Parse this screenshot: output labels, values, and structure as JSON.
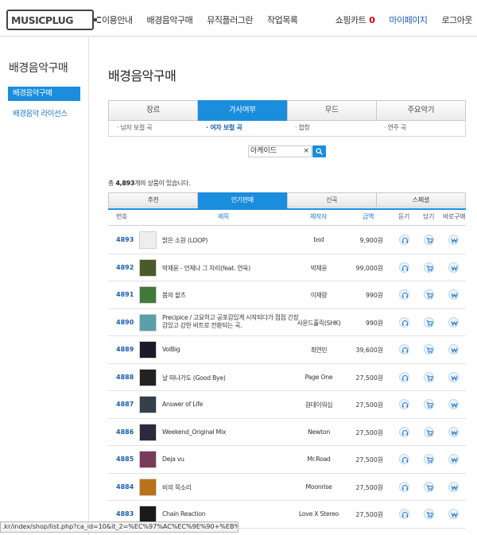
{
  "header": {
    "logo_text": "MUSICPLUG",
    "nav": [
      "이용안내",
      "배경음악구매",
      "뮤직플러그란",
      "작업목록"
    ],
    "cart_label": "쇼핑카트",
    "cart_count": "0",
    "mypage": "마이페이지",
    "logout": "로그아웃"
  },
  "sidebar": {
    "title": "배경음악구매",
    "items": [
      {
        "label": "배경음악구매",
        "active": true
      },
      {
        "label": "배경음악 라이선스",
        "active": false
      }
    ]
  },
  "main": {
    "title": "배경음악구매",
    "filter_tabs": [
      {
        "label": "장르",
        "active": false
      },
      {
        "label": "가사여부",
        "active": true
      },
      {
        "label": "무드",
        "active": false
      },
      {
        "label": "주요악기",
        "active": false
      }
    ],
    "filter_options": [
      {
        "label": "남자 보컬 곡",
        "active": false
      },
      {
        "label": "여자 보컬 곡",
        "active": true
      },
      {
        "label": "합창",
        "active": false
      },
      {
        "label": "연주 곡",
        "active": false
      }
    ],
    "search": {
      "value": "아케이드",
      "clear": "×"
    },
    "total": {
      "prefix": "총 ",
      "count": "4,893",
      "suffix": "개의 상품이 있습니다."
    },
    "sort_tabs": [
      {
        "label": "추천",
        "active": false
      },
      {
        "label": "인기판매",
        "active": true
      },
      {
        "label": "신곡",
        "active": false
      },
      {
        "label": "스페셜",
        "active": false
      }
    ],
    "columns": {
      "num": "번호",
      "title": "제목",
      "producer": "제작자",
      "price": "금액",
      "listen": "듣기",
      "cart": "담기",
      "buy": "바로구매"
    },
    "rows": [
      {
        "num": "4893",
        "title": "밝은 소원 (LOOP)",
        "producer": "bsd",
        "price": "9,900원",
        "thumb": "#eeeeee"
      },
      {
        "num": "4892",
        "title": "박재윤 - 언제나 그 자리(feat. 연욱)",
        "producer": "박재윤",
        "price": "99,000원",
        "thumb": "#4a5a2a"
      },
      {
        "num": "4891",
        "title": "봄의 왈츠",
        "producer": "이재량",
        "price": "990원",
        "thumb": "#3f7a3a"
      },
      {
        "num": "4890",
        "title": "Precipice / 고요하고 공포감있게 시작되다가 점점 긴장감있고 강한 비트로 전환되는 곡.",
        "producer": "사운드홀릭(SHK)",
        "price": "990원",
        "thumb": "#5aa0a8"
      },
      {
        "num": "4889",
        "title": "VolBig",
        "producer": "최연민",
        "price": "39,600원",
        "thumb": "#1a1a2a"
      },
      {
        "num": "4888",
        "title": "날 떠나가도 (Good Bye)",
        "producer": "Page One",
        "price": "27,500원",
        "thumb": "#222222"
      },
      {
        "num": "4887",
        "title": "Answer of Life",
        "producer": "원데이워십",
        "price": "27,500원",
        "thumb": "#35404a"
      },
      {
        "num": "4886",
        "title": "Weekend_Original Mix",
        "producer": "Newton",
        "price": "27,500원",
        "thumb": "#2a2a3a"
      },
      {
        "num": "4885",
        "title": "Deja vu",
        "producer": "Mr.Road",
        "price": "27,500원",
        "thumb": "#7a3a5a"
      },
      {
        "num": "4884",
        "title": "비의 목소리",
        "producer": "Moonrise",
        "price": "27,500원",
        "thumb": "#b8721a"
      },
      {
        "num": "4883",
        "title": "Chain Reaction",
        "producer": "Love X Stereo",
        "price": "27,500원",
        "thumb": "#1a1a1a"
      }
    ]
  },
  "status_url": ".kr/index/shop/list.php?ca_id=10&it_2=%EC%97%AC%EC%9E%90+%EB%B3%B4%EC...",
  "colors": {
    "accent": "#1a8ddd",
    "link": "#1a5fa8",
    "cart_count": "#cc0000"
  }
}
